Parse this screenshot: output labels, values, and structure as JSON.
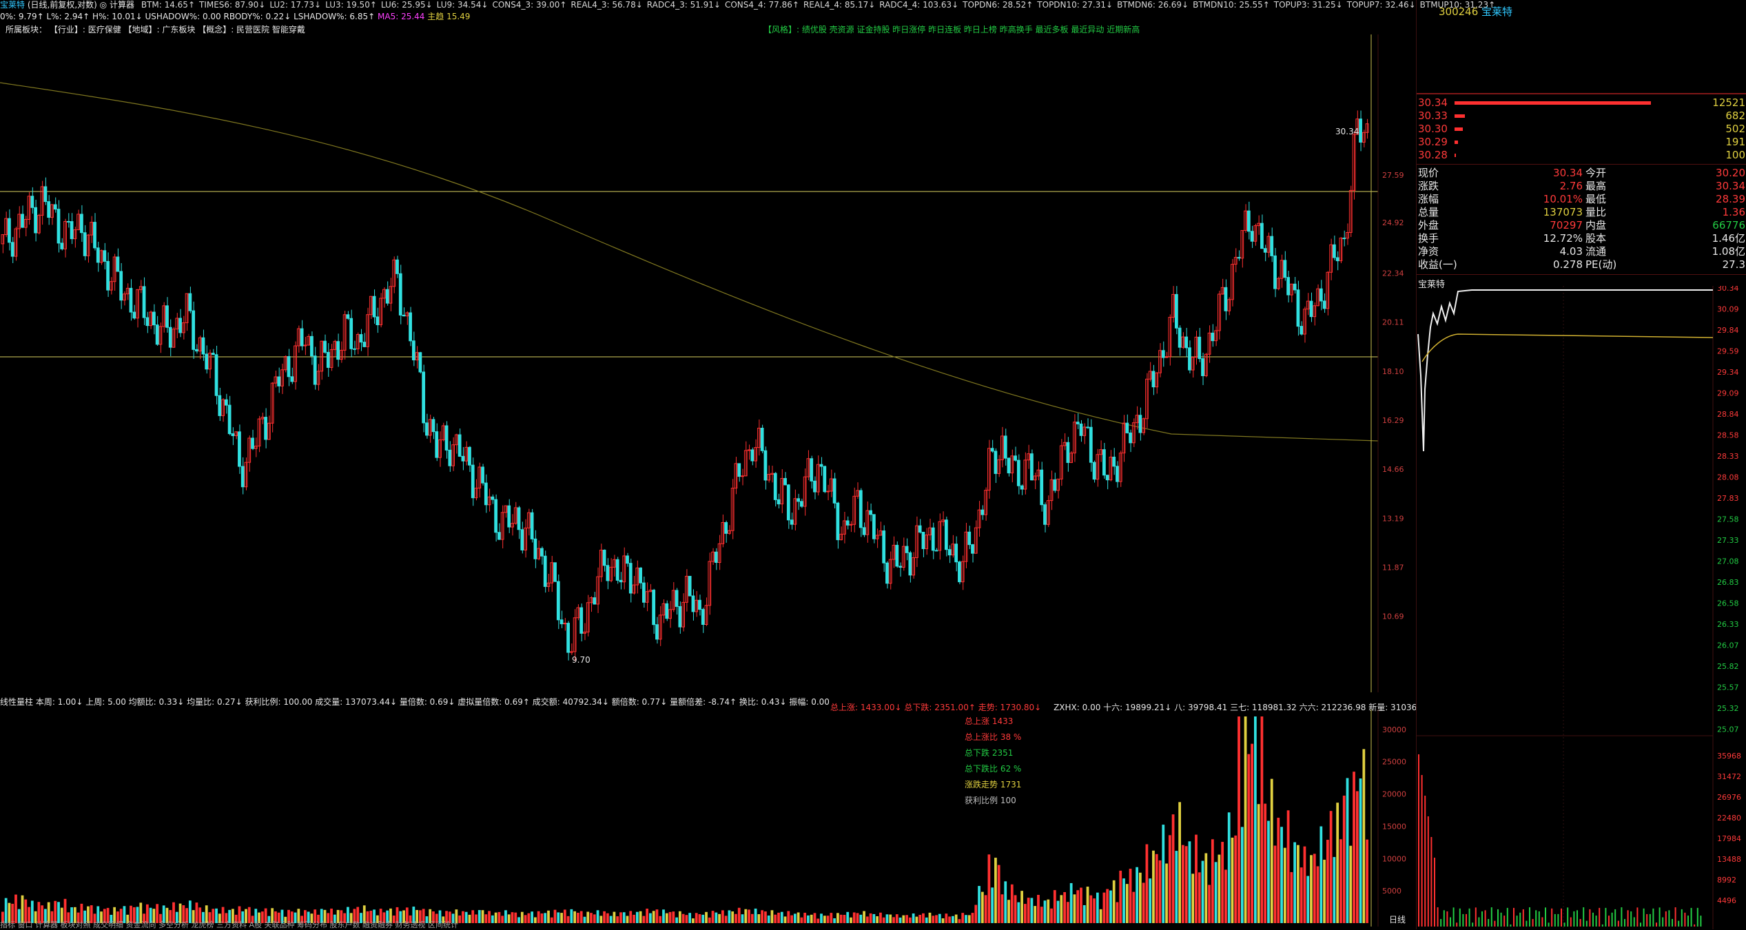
{
  "header": {
    "stock_name": "宝莱特",
    "mode": "(日线,前复权,对数)",
    "calc": "计算器",
    "indicators": [
      {
        "k": "BTM",
        "v": "14.65"
      },
      {
        "k": "TIMES6",
        "v": "87.90"
      },
      {
        "k": "LU2",
        "v": "17.73"
      },
      {
        "k": "LU3",
        "v": "19.50"
      },
      {
        "k": "LU6",
        "v": "25.95"
      },
      {
        "k": "LU9",
        "v": "34.54"
      },
      {
        "k": "CONS4_3",
        "v": "39.00"
      },
      {
        "k": "REAL4_3",
        "v": "56.78"
      },
      {
        "k": "RADC4_3",
        "v": "51.91"
      },
      {
        "k": "CONS4_4",
        "v": "77.86"
      },
      {
        "k": "REAL4_4",
        "v": "85.17"
      },
      {
        "k": "RADC4_4",
        "v": "103.63"
      },
      {
        "k": "TOPDN6",
        "v": "28.52"
      },
      {
        "k": "TOPDN10",
        "v": "27.31"
      },
      {
        "k": "BTMDN6",
        "v": "26.69"
      },
      {
        "k": "BTMDN10",
        "v": "25.55"
      },
      {
        "k": "TOPUP3",
        "v": "31.25"
      },
      {
        "k": "TOPUP7",
        "v": "32.46"
      },
      {
        "k": "BTMUP10",
        "v": "31.23"
      }
    ],
    "line2": "0%: 9.79↑ L%: 2.94↑ H%: 10.01↓ USHADOW%: 0.00 RBODY%: 0.22↓ LSHADOW%: 6.85↑",
    "ma5": "MA5: 25.44",
    "zhuli": "主趋 15.49",
    "sector_label": "所属板块：",
    "sectors": "【行业】: 医疗保健 【地域】: 广东板块 【概念】: 民营医院 智能穿戴",
    "style_tags": "【风格】: 绩优股 壳资源 证金持股 昨日涨停 昨日连板 昨日上榜 昨高换手 最近多板 最近异动 近期新高"
  },
  "price_axis": [
    "27.59",
    "24.92",
    "22.34",
    "20.11",
    "18.10",
    "16.29",
    "14.66",
    "13.19",
    "11.87",
    "10.69"
  ],
  "price_marks": {
    "high_label": "30.34",
    "low_label": "9.70"
  },
  "lower_head": "线性量柱 本周: 1.00↓ 上周: 5.00 均额比: 0.33↓ 均量比: 0.27↓ 获利比例: 100.00 成交量: 137073.44↓ 量倍数: 0.69↓ 虚拟量倍数: 0.69↑ 成交额: 40792.34↓ 额倍数: 0.77↓ 量额倍差: -8.74↑ 换比: 0.43↓ 振幅: 0.00",
  "lower_stats": "总上涨: 1433.00↓ 总下跌: 2351.00↑ 走势: 1730.80↓",
  "lower_stats2": "ZXHX: 0.00 十六: 19899.21↓ 八: 39798.41 三七: 118981.32 六六: 212236.98 新量: 31036",
  "legend": [
    {
      "t": "总上涨 1433",
      "c": "#ff3a3a"
    },
    {
      "t": "总上涨比 38 %",
      "c": "#ff3a3a"
    },
    {
      "t": "总下跌 2351",
      "c": "#22cc44"
    },
    {
      "t": "总下跌比 62 %",
      "c": "#22cc44"
    },
    {
      "t": "涨跌走势 1731",
      "c": "#e0d040"
    },
    {
      "t": "获利比例 100",
      "c": "#c0c0c0"
    }
  ],
  "volume_axis": [
    "30000",
    "25000",
    "20000",
    "15000",
    "10000",
    "5000"
  ],
  "bottom_tabs": "指标 窗口 计算器 板块对照 成交明细 资金流向 多空分析 龙虎榜 三方资料 A股 关联品种 筹码分布 股东户数 融资融券 财务透视 区间统计",
  "period_label": "日线",
  "sidebar": {
    "code": "300246",
    "name": "宝莱特",
    "order_book": [
      {
        "p": "30.34",
        "v": "12521",
        "w": 0.95
      },
      {
        "p": "30.33",
        "v": "682",
        "w": 0.05
      },
      {
        "p": "30.30",
        "v": "502",
        "w": 0.04
      },
      {
        "p": "30.29",
        "v": "191",
        "w": 0.015
      },
      {
        "p": "30.28",
        "v": "100",
        "w": 0.008
      }
    ],
    "quote": [
      {
        "l": "现价",
        "v": "30.34",
        "l2": "今开",
        "v2": "30.20",
        "c1": "red",
        "c2": "red"
      },
      {
        "l": "涨跌",
        "v": "2.76",
        "l2": "最高",
        "v2": "30.34",
        "c1": "red",
        "c2": "red"
      },
      {
        "l": "涨幅",
        "v": "10.01%",
        "l2": "最低",
        "v2": "28.39",
        "c1": "red",
        "c2": "red"
      },
      {
        "l": "总量",
        "v": "137073",
        "l2": "量比",
        "v2": "1.36",
        "c1": "yel",
        "c2": "red"
      },
      {
        "l": "外盘",
        "v": "70297",
        "l2": "内盘",
        "v2": "66776",
        "c1": "red",
        "c2": "grn"
      },
      {
        "l": "换手",
        "v": "12.72%",
        "l2": "股本",
        "v2": "1.46亿",
        "c1": "wht",
        "c2": "wht"
      },
      {
        "l": "净资",
        "v": "4.03",
        "l2": "流通",
        "v2": "1.08亿",
        "c1": "wht",
        "c2": "wht"
      },
      {
        "l": "收益(一)",
        "v": "0.278",
        "l2": "PE(动)",
        "v2": "27.3",
        "c1": "wht",
        "c2": "wht"
      }
    ],
    "mini_title": "宝莱特",
    "mini_axis": [
      "30.34",
      "30.09",
      "29.84",
      "29.59",
      "29.34",
      "29.09",
      "28.84",
      "28.58",
      "28.33",
      "28.08",
      "27.83",
      "27.58",
      "27.33",
      "27.08",
      "26.83",
      "26.58",
      "26.33",
      "26.07",
      "25.82",
      "25.57",
      "25.32",
      "25.07"
    ],
    "mini_vol_axis": [
      "35968",
      "31472",
      "26976",
      "22480",
      "17984",
      "13488",
      "8992",
      "4496"
    ]
  },
  "chart_data": {
    "type": "candlestick",
    "title": "宝莱特 (日线,前复权,对数)",
    "price_range": [
      9.7,
      30.34
    ],
    "close_path": [
      23.8,
      24.6,
      25.3,
      26.1,
      25.0,
      24.2,
      24.8,
      23.5,
      22.6,
      21.6,
      21.0,
      20.5,
      19.7,
      19.9,
      20.4,
      19.1,
      18.0,
      16.5,
      14.8,
      15.3,
      16.4,
      17.8,
      18.6,
      19.4,
      18.2,
      18.9,
      19.6,
      19.3,
      20.2,
      21.4,
      22.0,
      19.5,
      16.8,
      15.3,
      15.6,
      15.0,
      14.4,
      13.6,
      13.0,
      13.2,
      12.7,
      12.1,
      11.2,
      10.1,
      10.5,
      11.3,
      12.1,
      11.6,
      11.8,
      11.0,
      10.6,
      10.9,
      11.2,
      10.7,
      11.9,
      13.1,
      14.5,
      15.6,
      14.8,
      13.9,
      13.4,
      14.1,
      14.8,
      13.7,
      12.8,
      13.6,
      13.0,
      12.2,
      11.9,
      12.3,
      12.6,
      12.8,
      12.4,
      11.9,
      12.9,
      14.6,
      15.5,
      14.3,
      15.0,
      13.6,
      14.1,
      15.6,
      16.0,
      15.1,
      14.4,
      15.3,
      16.0,
      17.1,
      18.6,
      20.3,
      19.0,
      18.3,
      19.7,
      21.3,
      23.6,
      25.2,
      23.4,
      22.6,
      21.3,
      20.2,
      21.0,
      22.7,
      24.0,
      30.34
    ],
    "volume_path": [
      3.2,
      3.6,
      2.8,
      2.6,
      3.0,
      2.2,
      2.4,
      2.1,
      2.0,
      2.2,
      2.6,
      2.4,
      2.3,
      2.6,
      2.8,
      2.2,
      2.0,
      1.9,
      2.1,
      1.8,
      1.9,
      1.7,
      1.8,
      1.7,
      1.9,
      1.8,
      2.0,
      2.2,
      1.8,
      1.9,
      2.0,
      2.1,
      1.8,
      1.6,
      1.7,
      1.6,
      1.8,
      1.5,
      1.6,
      1.4,
      1.5,
      1.6,
      1.7,
      1.8,
      1.5,
      1.6,
      1.4,
      1.5,
      1.6,
      1.8,
      1.7,
      1.5,
      1.3,
      1.4,
      1.6,
      1.7,
      1.9,
      1.8,
      1.6,
      1.5,
      1.4,
      1.3,
      1.2,
      1.3,
      1.4,
      1.5,
      1.3,
      1.2,
      1.1,
      1.2,
      1.3,
      1.2,
      1.1,
      1.3,
      4.8,
      8.6,
      5.2,
      4.0,
      3.5,
      3.2,
      4.1,
      5.0,
      4.6,
      3.9,
      5.4,
      6.8,
      7.4,
      9.8,
      12.2,
      15.0,
      11.0,
      9.2,
      10.5,
      14.0,
      26.5,
      30.0,
      18.0,
      14.0,
      11.0,
      9.5,
      12.0,
      15.0,
      19.0,
      22.4
    ]
  }
}
